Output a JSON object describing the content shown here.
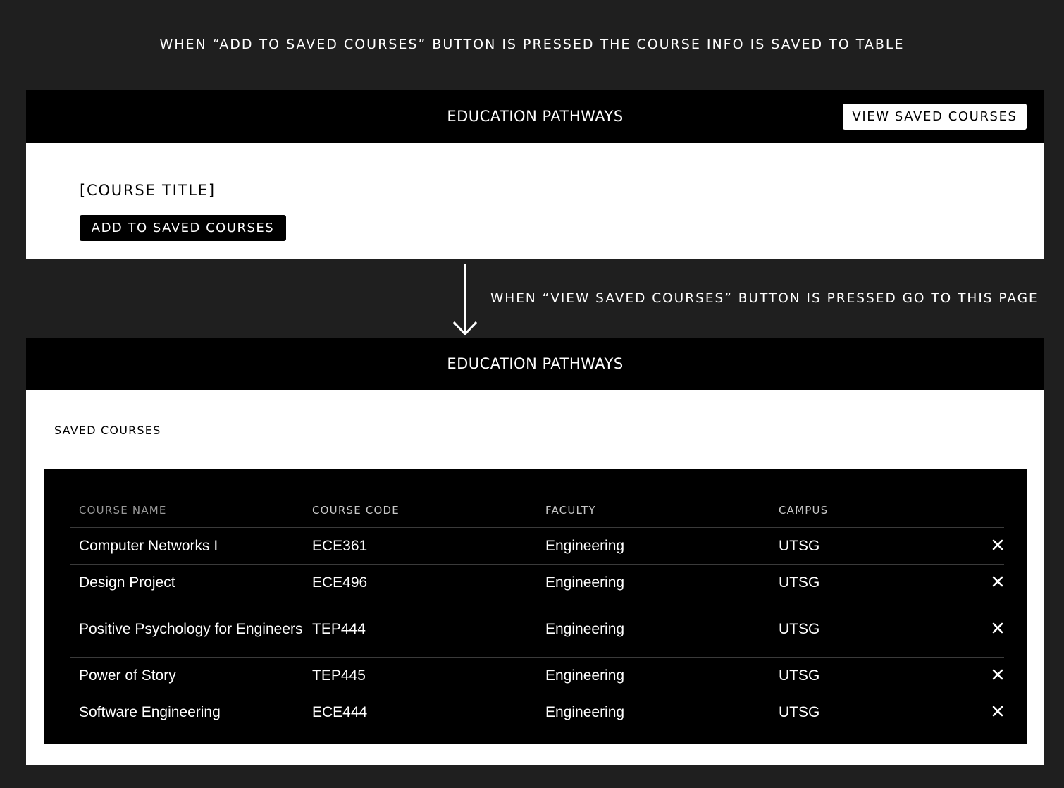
{
  "annotations": {
    "top": "WHEN “ADD TO SAVED COURSES” BUTTON IS PRESSED THE COURSE INFO IS SAVED TO TABLE",
    "middle": "WHEN “VIEW SAVED COURSES” BUTTON IS PRESSED GO TO THIS PAGE"
  },
  "screen1": {
    "nav_title": "EDUCATION PATHWAYS",
    "view_saved_label": "VIEW SAVED COURSES",
    "course_title": "[COURSE TITLE]",
    "add_button_label": "ADD TO SAVED COURSES"
  },
  "screen2": {
    "nav_title": "EDUCATION PATHWAYS",
    "heading": "SAVED COURSES",
    "table": {
      "headers": [
        "COURSE NAME",
        "COURSE CODE",
        "FACULTY",
        "CAMPUS"
      ],
      "rows": [
        {
          "name": "Computer Networks I",
          "code": "ECE361",
          "faculty": "Engineering",
          "campus": "UTSG"
        },
        {
          "name": "Design Project",
          "code": "ECE496",
          "faculty": "Engineering",
          "campus": "UTSG"
        },
        {
          "name": "Positive Psychology for Engineers",
          "code": "TEP444",
          "faculty": "Engineering",
          "campus": "UTSG"
        },
        {
          "name": "Power of Story",
          "code": "TEP445",
          "faculty": "Engineering",
          "campus": "UTSG"
        },
        {
          "name": "Software Engineering",
          "code": "ECE444",
          "faculty": "Engineering",
          "campus": "UTSG"
        }
      ],
      "remove_icon": "close-icon"
    }
  },
  "colors": {
    "background": "#1f1f1f",
    "bar": "#000000",
    "panel": "#ffffff",
    "divider": "#3a3a3a"
  }
}
